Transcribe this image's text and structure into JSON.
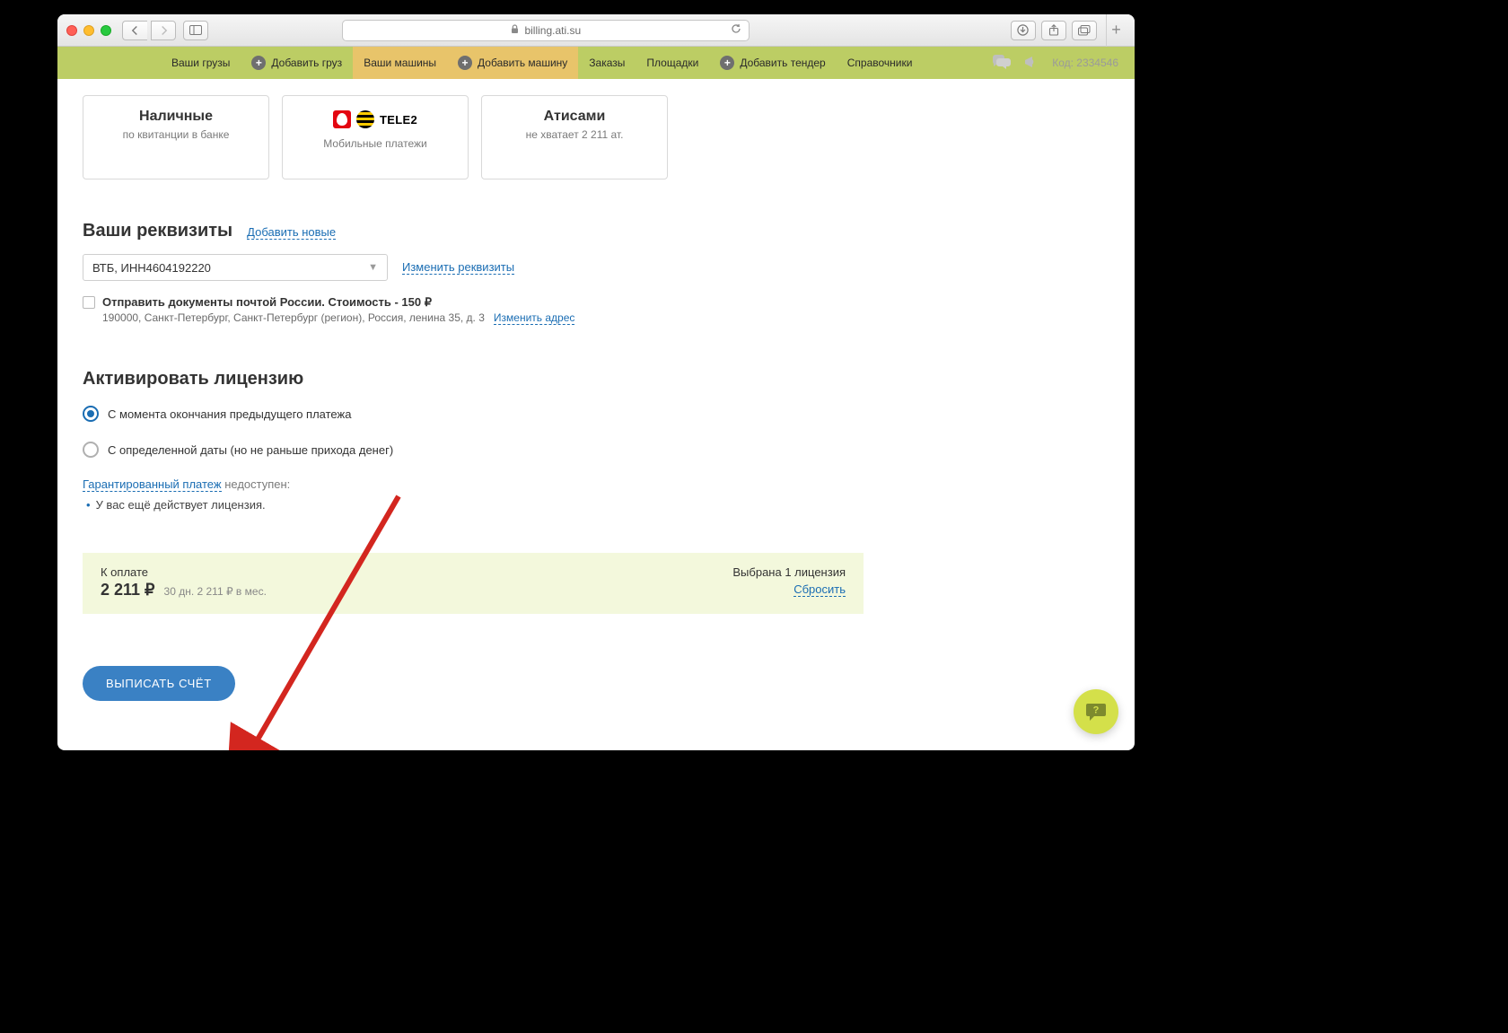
{
  "browser": {
    "url": "billing.ati.su"
  },
  "nav": {
    "cargo": "Ваши грузы",
    "add_cargo": "Добавить груз",
    "vehicles": "Ваши машины",
    "add_vehicle": "Добавить машину",
    "orders": "Заказы",
    "platforms": "Площадки",
    "add_tender": "Добавить тендер",
    "refs": "Справочники",
    "code_label": "Код: 2334546"
  },
  "cards": {
    "cash_title": "Наличные",
    "cash_sub": "по квитанции в банке",
    "mobile_title": "Мобильные платежи",
    "mobile_tele2": "TELE2",
    "atisami_title": "Атисами",
    "atisami_sub": "не хватает 2 211 ат."
  },
  "requisites": {
    "heading": "Ваши реквизиты",
    "add_new": "Добавить новые",
    "select_value": "ВТБ, ИНН4604192220",
    "edit_link": "Изменить реквизиты",
    "chk_bold": "Отправить документы почтой России. Стоимость - 150 ₽",
    "chk_addr": "190000, Санкт-Петербург, Санкт-Петербург (регион), Россия, ленина 35, д. 3",
    "chk_edit": "Изменить адрес"
  },
  "activate": {
    "heading": "Активировать лицензию",
    "opt1": "С момента окончания предыдущего платежа",
    "opt2": "С определенной даты (но не раньше прихода денег)",
    "guar_link": "Гарантированный платеж",
    "guar_rest": " недоступен:",
    "bullet": "У вас ещё действует лицензия."
  },
  "summary": {
    "label": "К оплате",
    "amount": "2 211 ₽",
    "per": "30 дн.  2 211 ₽ в мес.",
    "selected": "Выбрана 1 лицензия",
    "reset": "Сбросить"
  },
  "cta_label": "ВЫПИСАТЬ СЧЁТ"
}
